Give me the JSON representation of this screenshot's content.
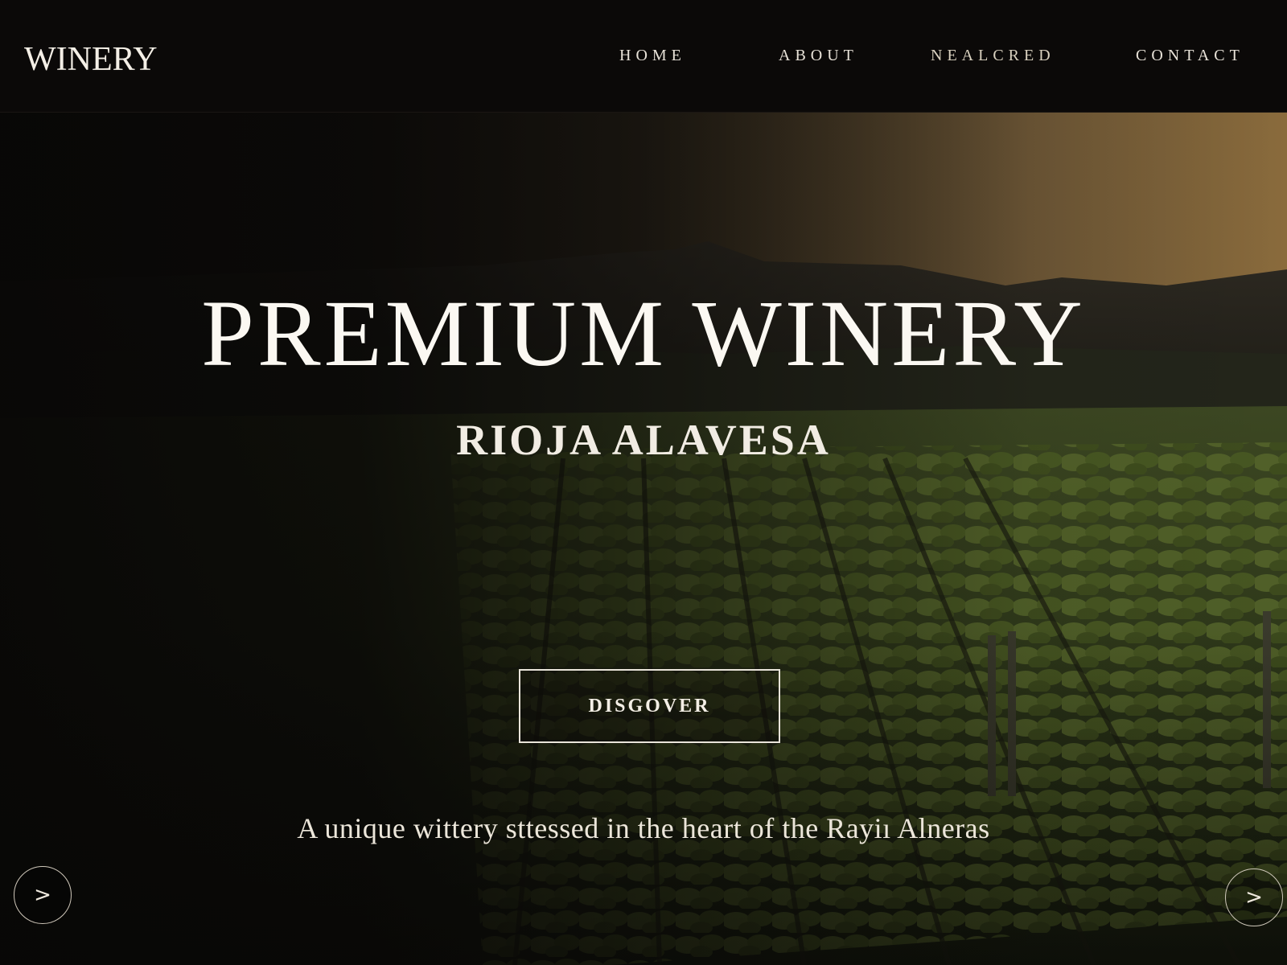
{
  "header": {
    "logo": "WINERY",
    "nav": [
      "HOME",
      "ABOUT",
      "NEALCRED",
      "CONTACT"
    ]
  },
  "hero": {
    "title": "PREMIUM WINERY",
    "subtitle": "RIOJA ALAVESA",
    "button_label": "DISGOVER",
    "tagline": "A unique wittery sttessed in the heart of the Rayiı Alneras",
    "prev_arrow": ">",
    "next_arrow": ">"
  },
  "colors": {
    "background": "#0b0908",
    "text": "#f4efe6",
    "sky_glow": "#c49650",
    "vines": "#4a5a22"
  },
  "icons": {
    "prev": "chevron-right-icon",
    "next": "chevron-right-icon"
  }
}
